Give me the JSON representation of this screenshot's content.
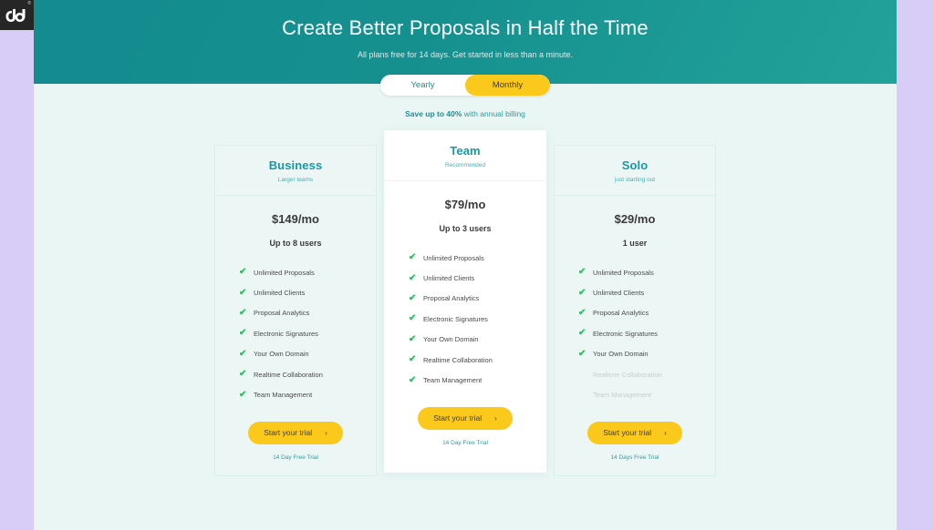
{
  "brand": {
    "logo_alt": "pd",
    "registered_mark": "®"
  },
  "hero": {
    "title": "Create Better Proposals in Half the Time",
    "subtitle": "All plans free for 14 days. Get started in less than a minute."
  },
  "billing_toggle": {
    "yearly_label": "Yearly",
    "monthly_label": "Monthly",
    "selected": "Monthly"
  },
  "savings": {
    "bold": "Save up to 40%",
    "rest": " with annual billing"
  },
  "recommended_label": "RECOMENDED",
  "cta": {
    "label": "Start your trial",
    "arrow": "›"
  },
  "plans": [
    {
      "name": "Business",
      "tagline": "Larger teams",
      "price": "$149/mo",
      "seats": "Up to 8 users",
      "trial_note": "14 Day Free Trial",
      "featured": false,
      "features": [
        {
          "label": "Unlimited Proposals",
          "included": true
        },
        {
          "label": "Unlimited Clients",
          "included": true
        },
        {
          "label": "Proposal Analytics",
          "included": true
        },
        {
          "label": "Electronic Signatures",
          "included": true
        },
        {
          "label": "Your Own Domain",
          "included": true
        },
        {
          "label": "Realtime Collaboration",
          "included": true
        },
        {
          "label": "Team Management",
          "included": true
        }
      ]
    },
    {
      "name": "Team",
      "tagline": "Recommended",
      "price": "$79/mo",
      "seats": "Up to 3 users",
      "trial_note": "14 Day Free Trial",
      "featured": true,
      "features": [
        {
          "label": "Unlimited Proposals",
          "included": true
        },
        {
          "label": "Unlimited Clients",
          "included": true
        },
        {
          "label": "Proposal Analytics",
          "included": true
        },
        {
          "label": "Electronic Signatures",
          "included": true
        },
        {
          "label": "Your Own Domain",
          "included": true
        },
        {
          "label": "Realtime Collaboration",
          "included": true
        },
        {
          "label": "Team Management",
          "included": true
        }
      ]
    },
    {
      "name": "Solo",
      "tagline": "just starting out",
      "price": "$29/mo",
      "seats": "1 user",
      "trial_note": "14 Days Free Trial",
      "featured": false,
      "features": [
        {
          "label": "Unlimited Proposals",
          "included": true
        },
        {
          "label": "Unlimited Clients",
          "included": true
        },
        {
          "label": "Proposal Analytics",
          "included": true
        },
        {
          "label": "Electronic Signatures",
          "included": true
        },
        {
          "label": "Your Own Domain",
          "included": true
        },
        {
          "label": "Realtime Collaboration",
          "included": false
        },
        {
          "label": "Team Management",
          "included": false
        }
      ]
    }
  ],
  "colors": {
    "hero_teal": "#15908f",
    "page_bg": "#e9f6f4",
    "outer_bg": "#d8cdf7",
    "accent_yellow": "#fbc91b",
    "plan_name_teal": "#1a97a5",
    "check_green": "#22c55e",
    "muted_feature": "#c2cfce"
  }
}
